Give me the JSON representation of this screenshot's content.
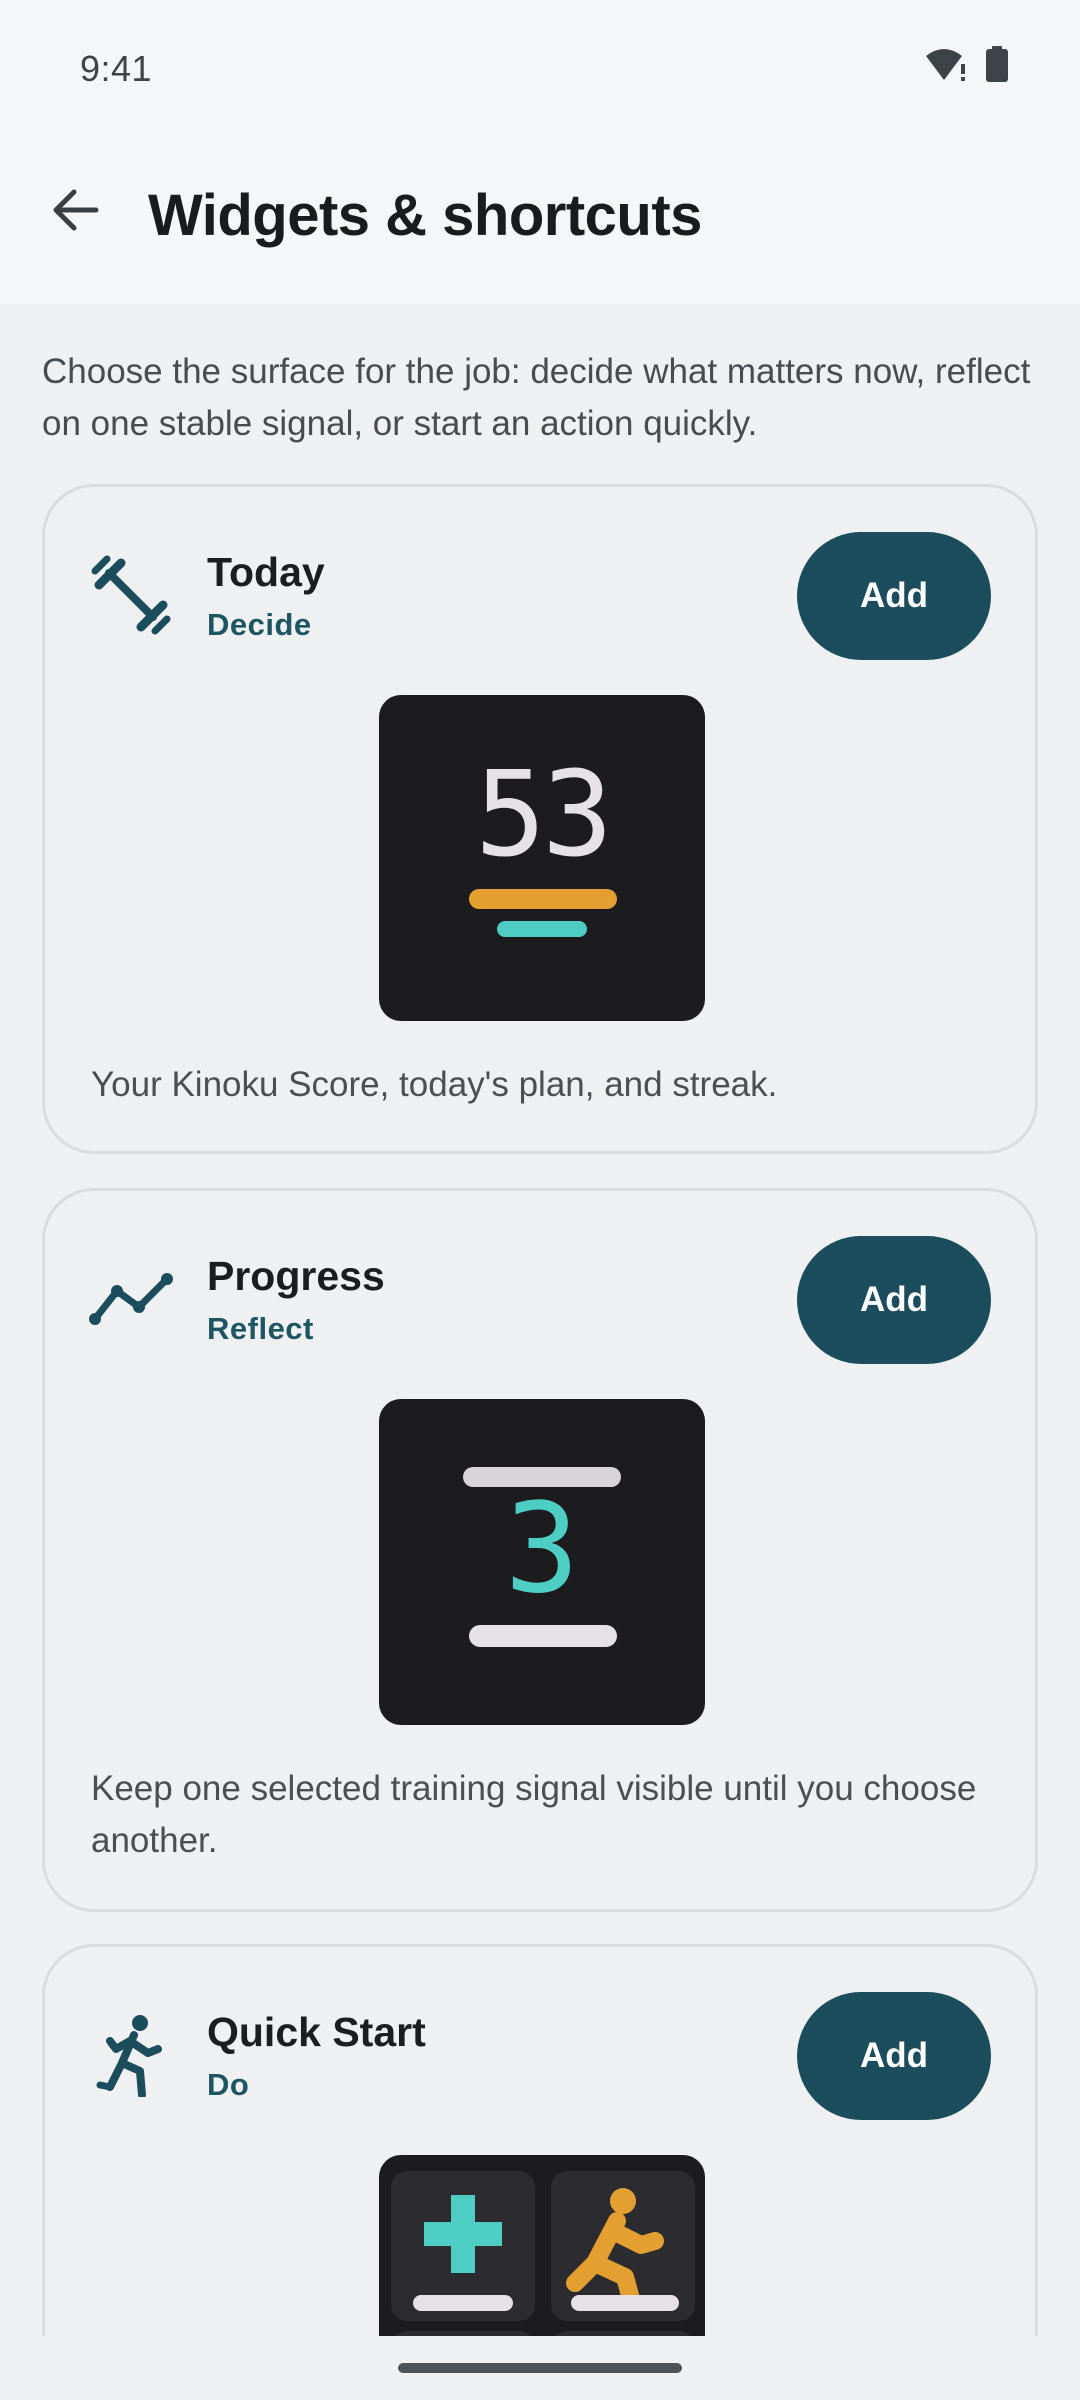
{
  "status_bar": {
    "time": "9:41",
    "wifi_icon": "wifi-alert-icon",
    "battery_icon": "battery-icon"
  },
  "app_bar": {
    "title": "Widgets & shortcuts",
    "back_icon": "arrow-back-icon"
  },
  "intro": "Choose the surface for the job: decide what matters now, reflect on one stable signal, or start an action quickly.",
  "colors": {
    "accent": "#1B4D5C",
    "subtitle": "#1D5563",
    "teal": "#4ECDC4",
    "amber": "#E3A030",
    "widget_bg": "#1C1C1E"
  },
  "cards": [
    {
      "title": "Today",
      "subtitle": "Decide",
      "icon": "dumbbell-icon",
      "button": "Add",
      "description": "Your Kinoku Score, today's plan, and streak.",
      "preview_digits": "53"
    },
    {
      "title": "Progress",
      "subtitle": "Reflect",
      "icon": "trend-line-icon",
      "button": "Add",
      "description": "Keep one selected training signal visible until you choose another.",
      "preview_digit": "3"
    },
    {
      "title": "Quick Start",
      "subtitle": "Do",
      "icon": "running-person-icon",
      "button": "Add",
      "description": ""
    }
  ]
}
